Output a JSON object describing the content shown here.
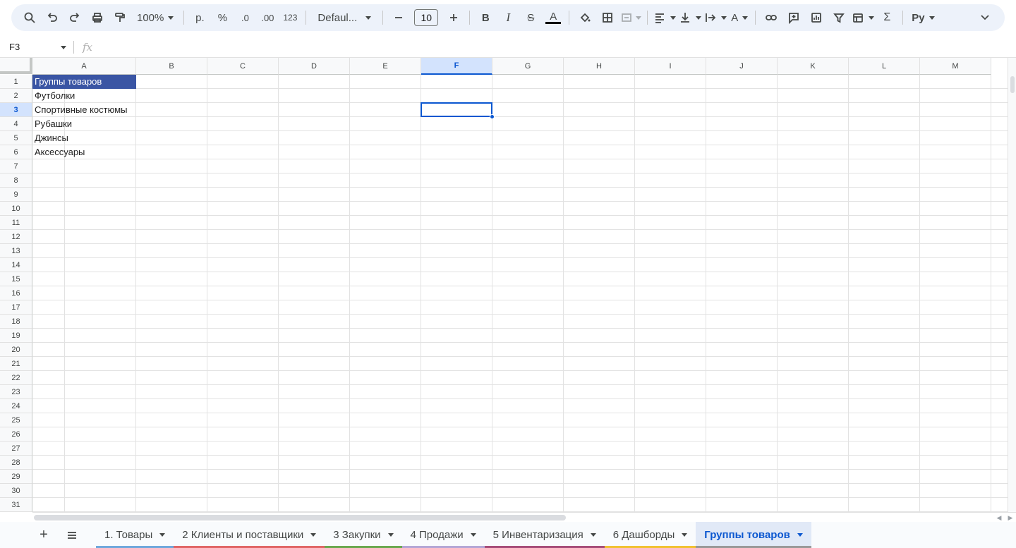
{
  "toolbar": {
    "zoom": "100%",
    "currency": "р.",
    "percent": "%",
    "decrease_decimal": ".0",
    "increase_decimal": ".00",
    "number_format": "123",
    "font": "Defaul...",
    "font_size": "10",
    "minus": "—",
    "plus": "+"
  },
  "formula_bar": {
    "cell_ref": "F3",
    "fx": "fx"
  },
  "columns": [
    "A",
    "B",
    "C",
    "D",
    "E",
    "F",
    "G",
    "H",
    "I",
    "J",
    "K",
    "L",
    "M"
  ],
  "selected_column": "F",
  "rows": [
    "1",
    "2",
    "3",
    "4",
    "5",
    "6",
    "7",
    "8",
    "9",
    "10",
    "11",
    "12",
    "13",
    "14",
    "15",
    "16",
    "17",
    "18",
    "19",
    "20",
    "21",
    "22",
    "23",
    "24",
    "25",
    "26",
    "27",
    "28",
    "29",
    "30",
    "31"
  ],
  "selected_row": "3",
  "cells": {
    "A1": "Группы товаров",
    "A2": "Футболки",
    "A3": "Спортивные костюмы",
    "A4": "Рубашки",
    "A5": "Джинсы",
    "A6": "Аксессуары"
  },
  "colors": {
    "header_fill": "#3a55a4",
    "selection": "#0b57d0"
  },
  "sheets": [
    {
      "label": "1. Товары",
      "color": "#6fa8dc"
    },
    {
      "label": "2 Клиенты и поставщики",
      "color": "#e06666"
    },
    {
      "label": "3 Закупки",
      "color": "#6aa84f"
    },
    {
      "label": "4 Продажи",
      "color": "#b4a7d6"
    },
    {
      "label": "5 Инвентаризация",
      "color": "#a64d79"
    },
    {
      "label": "6 Дашборды",
      "color": "#f1c232"
    },
    {
      "label": "Группы товаров",
      "color": "#999999",
      "active": true
    }
  ]
}
